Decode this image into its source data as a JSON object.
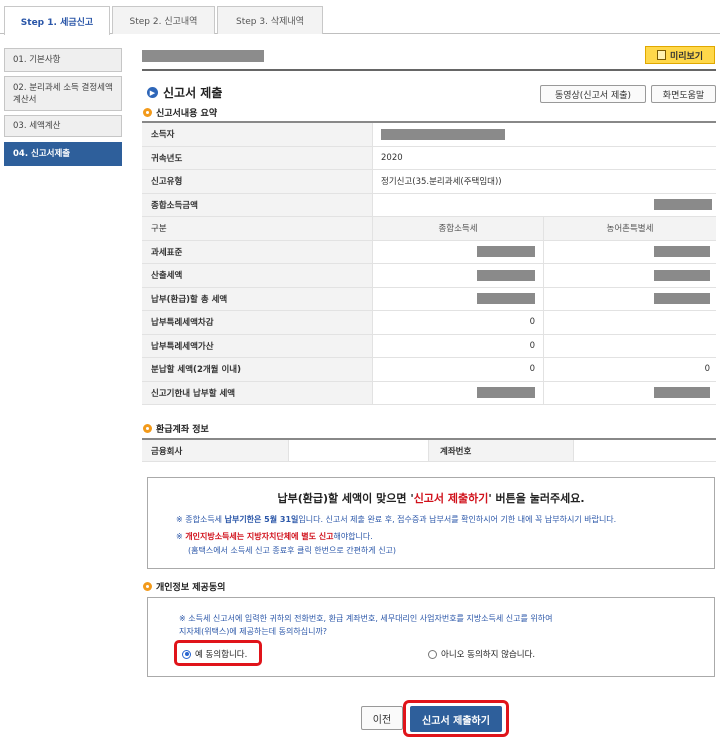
{
  "tabs": [
    {
      "label": "Step 1. 세금신고",
      "active": true
    },
    {
      "label": "Step 2. 신고내역",
      "active": false
    },
    {
      "label": "Step 3. 삭제내역",
      "active": false
    }
  ],
  "sidebar": {
    "items": [
      {
        "label": "01. 기본사항",
        "active": false
      },
      {
        "label": "02. 분리과세 소득 결정세액 계산서",
        "active": false
      },
      {
        "label": "03. 세액계산",
        "active": false
      },
      {
        "label": "04. 신고서제출",
        "active": true
      }
    ]
  },
  "header": {
    "preview_label": "미리보기",
    "section_title": "신고서 제출",
    "video_button": "동영상(신고서 제출)",
    "help_button": "화면도움말"
  },
  "summary": {
    "title": "신고서내용 요약",
    "taxpayer_label": "소득자",
    "year_label": "귀속년도",
    "year_value": "2020",
    "type_label": "신고유형",
    "type_value": "정기신고(35.분리과세(주택임대))",
    "total_income_label": "종합소득금액",
    "col_header_label": "구분",
    "col1_header": "종합소득세",
    "col2_header": "농어촌특별세",
    "rows": [
      {
        "label": "과세표준",
        "v1": "",
        "v2": ""
      },
      {
        "label": "산출세액",
        "v1": "",
        "v2": ""
      },
      {
        "label": "납부(환급)할 총 세액",
        "v1": "",
        "v2": ""
      },
      {
        "label": "납부특례세액차감",
        "v1": "0",
        "v2": ""
      },
      {
        "label": "납부특례세액가산",
        "v1": "0",
        "v2": ""
      },
      {
        "label": "분납할 세액(2개월 이내)",
        "v1": "0",
        "v2": "0"
      },
      {
        "label": "신고기한내 납부할 세액",
        "v1": "",
        "v2": ""
      }
    ]
  },
  "refund": {
    "title": "환급계좌 정보",
    "bank_label": "금융회사",
    "account_label": "계좌번호"
  },
  "notice": {
    "head_before": "납부(환급)할 세액이 맞으면 '",
    "head_red": "신고서 제출하기",
    "head_after": "' 버튼을 눌러주세요.",
    "line1_a": "※ 종합소득세 ",
    "line1_b": "납부기한은 5월 31일",
    "line1_c": "입니다. 신고서 제출 완료 후, 접수증과 납부서를 확인하시어 기한 내에 꼭 납부하시기 바랍니다.",
    "line2_a": "※ ",
    "line2_b": "개인지방소득세는 지방자치단체에 별도 신고",
    "line2_c": "해야합니다.",
    "line3": "(홈택스에서 소득세 신고 종료후 클릭 한번으로 간편하게 신고)"
  },
  "consent": {
    "title": "개인정보 제공동의",
    "text_line1": "※ 소득세 신고서에 입력한 귀하의 전화번호, 환급 계좌번호, 세무대리인 사업자번호를 지방소득세 신고를 위하여",
    "text_line2": "지자체(위택스)에 제공하는데 동의하십니까?",
    "agree_label": "예 동의합니다.",
    "disagree_label": "아니오 동의하지 않습니다.",
    "selected": "agree"
  },
  "footer": {
    "prev_label": "이전",
    "submit_label": "신고서 제출하기"
  },
  "colors": {
    "accent_blue": "#2e5f9b",
    "highlight_red": "#e0141a",
    "preview_yellow": "#ffd84a"
  }
}
